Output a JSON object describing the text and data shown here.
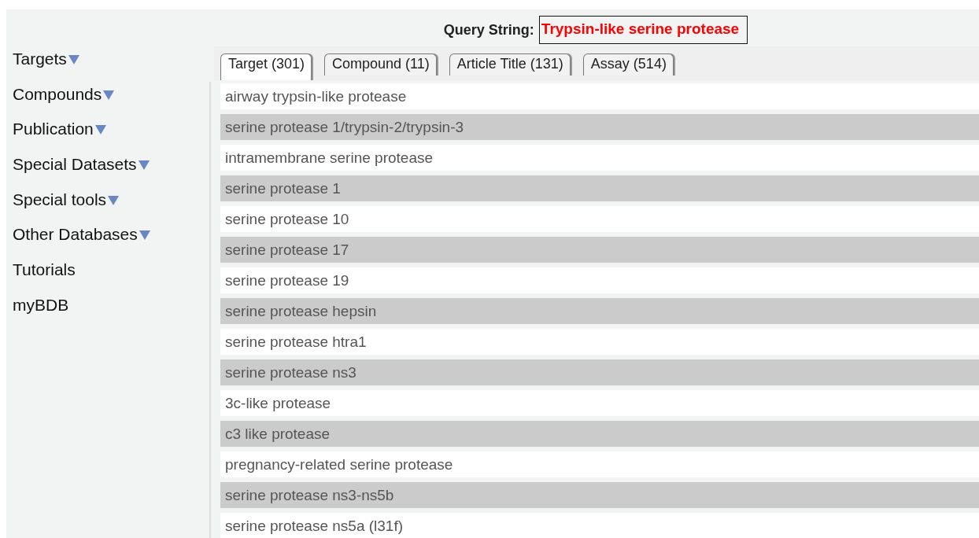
{
  "query": {
    "label": "Query String:",
    "value": "Trypsin-like serine protease"
  },
  "sidebar": [
    {
      "label": "Targets",
      "dropdown": true
    },
    {
      "label": "Compounds",
      "dropdown": true
    },
    {
      "label": "Publication",
      "dropdown": true
    },
    {
      "label": "Special Datasets",
      "dropdown": true
    },
    {
      "label": "Special tools",
      "dropdown": true
    },
    {
      "label": "Other Databases",
      "dropdown": true
    },
    {
      "label": "Tutorials",
      "dropdown": false
    },
    {
      "label": "myBDB",
      "dropdown": false
    }
  ],
  "tabs": [
    {
      "label": "Target (301)",
      "selected": true
    },
    {
      "label": "Compound (11)",
      "selected": false
    },
    {
      "label": "Article Title (131)",
      "selected": false
    },
    {
      "label": "Assay (514)",
      "selected": false
    }
  ],
  "results": [
    "airway trypsin-like protease",
    "serine protease 1/trypsin-2/trypsin-3",
    "intramembrane serine protease",
    "serine protease 1",
    "serine protease 10",
    "serine protease 17",
    "serine protease 19",
    "serine protease hepsin",
    "serine protease htra1",
    "serine protease ns3",
    "3c-like protease",
    "c3 like protease",
    "pregnancy-related serine protease",
    "serine protease ns3-ns5b",
    "serine protease ns5a (l31f)"
  ]
}
